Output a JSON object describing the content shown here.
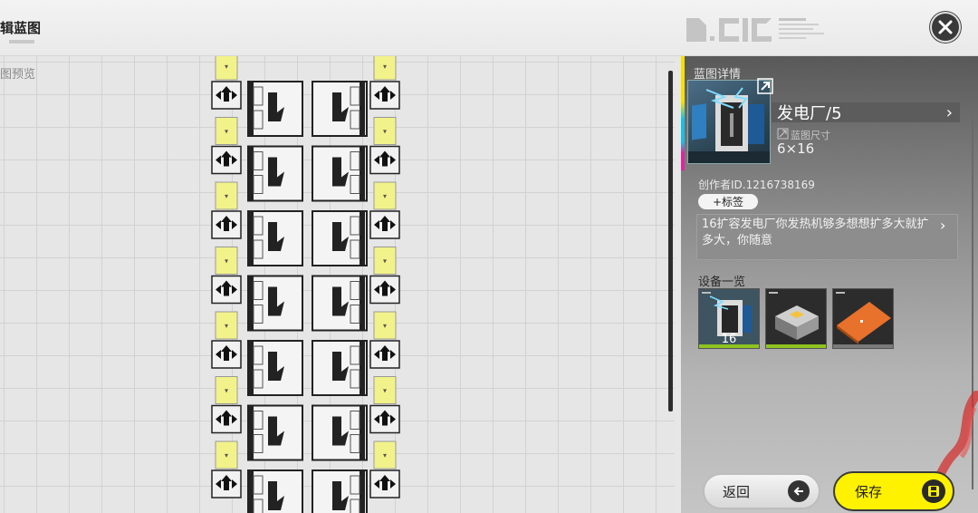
{
  "header": {
    "title": "辑蓝图",
    "logo_text": "B.CIC",
    "close_icon": "close-x-icon"
  },
  "canvas": {
    "label": "图预览",
    "colors": {
      "conveyor": "#f2f28a",
      "machine_border": "#222222"
    }
  },
  "details": {
    "section_title": "蓝图详情",
    "name": "发电厂/5",
    "size_label": "蓝图尺寸",
    "size_value": "6×16",
    "creator": "创作者ID.1216738169",
    "tag_button": "+标签",
    "description": "16扩容发电厂你发热机够多想想扩多大就扩多大，你随意",
    "equipment_title": "设备一览",
    "equipment": [
      {
        "name": "power-generator",
        "count": "16",
        "bar_color": "#8fc31f"
      },
      {
        "name": "heat-machine",
        "count": "",
        "bar_color": "#8fc31f"
      },
      {
        "name": "floor-plate",
        "count": "",
        "bar_color": "#7a7a7a"
      }
    ]
  },
  "actions": {
    "back_label": "返回",
    "save_label": "保存"
  },
  "theme": {
    "accent_yellow": "#fff200",
    "stripe_colors": [
      "#f5e100",
      "#18c0e8",
      "#e0269a"
    ]
  }
}
